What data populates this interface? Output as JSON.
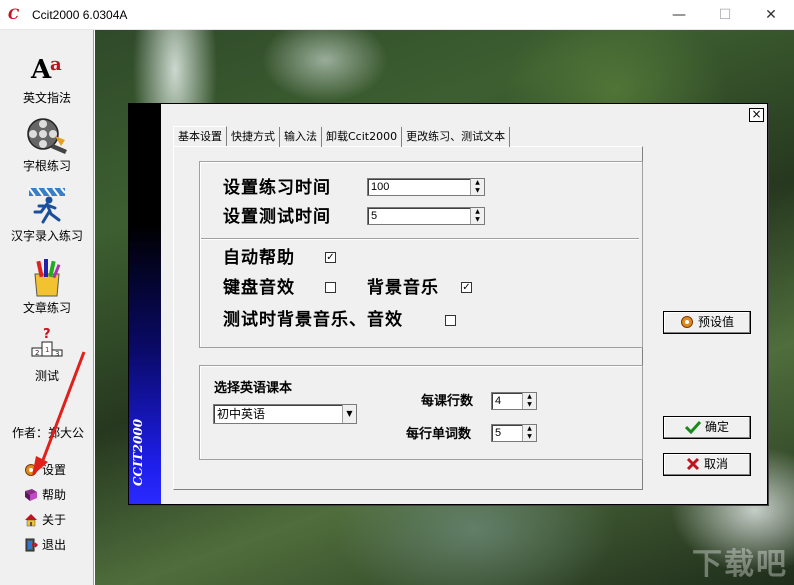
{
  "window": {
    "title": "Ccit2000 6.0304A",
    "icon": "ccit-logo-icon",
    "app_icon_text": "C",
    "min_glyph": "—",
    "max_glyph": "☐",
    "close_glyph": "✕"
  },
  "sidebar": {
    "items": [
      {
        "label": "英文指法",
        "icon": "english-letters-icon"
      },
      {
        "label": "字根练习",
        "icon": "film-reel-icon"
      },
      {
        "label": "汉字录入练习",
        "icon": "runner-icon"
      },
      {
        "label": "文章练习",
        "icon": "pencils-icon"
      },
      {
        "label": "测试",
        "icon": "podium-icon"
      }
    ],
    "author": "作者：郑大公",
    "mini_items": [
      {
        "label": "设置",
        "icon": "gear-icon"
      },
      {
        "label": "帮助",
        "icon": "book-icon"
      },
      {
        "label": "关于",
        "icon": "house-icon"
      },
      {
        "label": "退出",
        "icon": "exit-icon"
      }
    ]
  },
  "dialog": {
    "banner_text": "CCIT2000",
    "close_glyph": "×",
    "tabs": [
      "基本设置",
      "快捷方式",
      "输入法",
      "卸载Ccit2000",
      "更改练习、测试文本"
    ],
    "active_tab": 0,
    "practice_time_label": "设置练习时间",
    "practice_time_value": "100",
    "test_time_label": "设置测试时间",
    "test_time_value": "5",
    "auto_help_label": "自动帮助",
    "auto_help_checked": true,
    "key_sound_label": "键盘音效",
    "key_sound_checked": false,
    "bg_music_label": "背景音乐",
    "bg_music_checked": true,
    "test_bg_music_label": "测试时背景音乐、音效",
    "test_bg_music_checked": false,
    "textbook_label": "选择英语课本",
    "textbook_value": "初中英语",
    "lines_per_lesson_label": "每课行数",
    "lines_per_lesson_value": "4",
    "words_per_line_label": "每行单词数",
    "words_per_line_value": "5",
    "preset_button": "预设值",
    "ok_button": "确定",
    "cancel_button": "取消",
    "check_glyph": "✓"
  },
  "watermark": "下载吧",
  "colors": {
    "banner_blue": "#1e1eea",
    "ok_green": "#1a8a1a",
    "cancel_red": "#c0121f"
  }
}
